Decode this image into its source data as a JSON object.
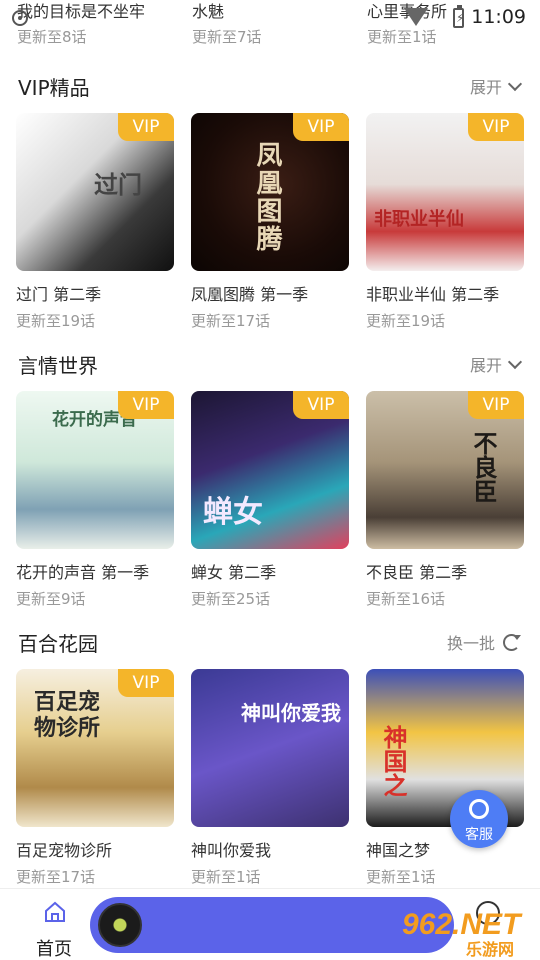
{
  "status_bar": {
    "time": "11:09"
  },
  "top_row": [
    {
      "title": "我的目标是不坐牢",
      "episodes": "更新至8话"
    },
    {
      "title": "水魅",
      "episodes": "更新至7话"
    },
    {
      "title": "心里事务所",
      "episodes": "更新至1话"
    }
  ],
  "sections": [
    {
      "title": "VIP精品",
      "action_label": "展开",
      "items": [
        {
          "name": "过门 第二季",
          "episodes": "更新至19话",
          "badge": "VIP",
          "cover_title": "过门"
        },
        {
          "name": "凤凰图腾 第一季",
          "episodes": "更新至17话",
          "badge": "VIP",
          "cover_title": "凤凰图腾"
        },
        {
          "name": "非职业半仙 第二季",
          "episodes": "更新至19话",
          "badge": "VIP",
          "cover_title": "非职业半仙"
        }
      ]
    },
    {
      "title": "言情世界",
      "action_label": "展开",
      "items": [
        {
          "name": "花开的声音 第一季",
          "episodes": "更新至9话",
          "badge": "VIP",
          "cover_title": "花开的声音"
        },
        {
          "name": "蝉女 第二季",
          "episodes": "更新至25话",
          "badge": "VIP",
          "cover_title": "蝉女"
        },
        {
          "name": "不良臣 第二季",
          "episodes": "更新至16话",
          "badge": "VIP",
          "cover_title": "不良臣"
        }
      ]
    },
    {
      "title": "百合花园",
      "action_label": "换一批",
      "items": [
        {
          "name": "百足宠物诊所",
          "episodes": "更新至17话",
          "badge": "VIP",
          "cover_title": "百足宠物诊所"
        },
        {
          "name": "神叫你爱我",
          "episodes": "更新至1话",
          "badge": "",
          "cover_title": "神叫你爱我"
        },
        {
          "name": "神国之梦",
          "episodes": "更新至1话",
          "badge": "",
          "cover_title": "神国之"
        }
      ]
    }
  ],
  "float_service": {
    "label": "客服"
  },
  "bottom_nav": {
    "home_label": "首页"
  },
  "watermark": {
    "big": "962.NET",
    "small": "乐游网"
  },
  "colors": {
    "vip_badge": "#f4b52a",
    "player_pill": "#5b63e9",
    "service_button": "#4e7df5"
  }
}
